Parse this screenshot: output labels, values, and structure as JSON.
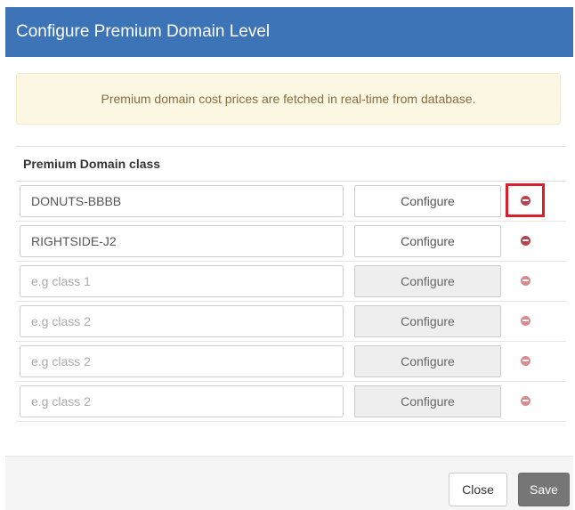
{
  "modal": {
    "title": "Configure Premium Domain Level"
  },
  "alert": {
    "message": "Premium domain cost prices are fetched in real-time from database."
  },
  "table": {
    "heading": "Premium Domain class",
    "rows": [
      {
        "value": "DONUTS-BBBB",
        "placeholder": "",
        "configure_label": "Configure",
        "configure_disabled": false,
        "remove_highlighted": true
      },
      {
        "value": "RIGHTSIDE-J2",
        "placeholder": "",
        "configure_label": "Configure",
        "configure_disabled": false,
        "remove_highlighted": false
      },
      {
        "value": "",
        "placeholder": "e.g class 1",
        "configure_label": "Configure",
        "configure_disabled": true,
        "remove_highlighted": false
      },
      {
        "value": "",
        "placeholder": "e.g class 2",
        "configure_label": "Configure",
        "configure_disabled": true,
        "remove_highlighted": false
      },
      {
        "value": "",
        "placeholder": "e.g class 2",
        "configure_label": "Configure",
        "configure_disabled": true,
        "remove_highlighted": false
      },
      {
        "value": "",
        "placeholder": "e.g class 2",
        "configure_label": "Configure",
        "configure_disabled": true,
        "remove_highlighted": false
      }
    ],
    "remove_icon": "minus-circle-icon"
  },
  "footer": {
    "close_label": "Close",
    "save_label": "Save"
  },
  "colors": {
    "header_bg": "#3d74b7",
    "alert_bg": "#fcf8e3",
    "alert_text": "#8a6d3b",
    "highlight_border": "#d9202a",
    "remove_icon": "#b5444c",
    "save_bg": "#767676"
  }
}
